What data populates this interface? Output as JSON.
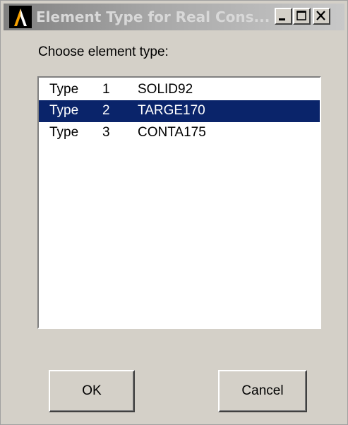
{
  "window": {
    "title": "Element Type for Real Cons...",
    "controls": {
      "minimize_icon": "minimize-icon",
      "maximize_icon": "maximize-icon",
      "close_icon": "close-icon"
    }
  },
  "prompt": "Choose element type:",
  "element_types": [
    {
      "label": "Type",
      "number": "1",
      "name": "SOLID92",
      "selected": false
    },
    {
      "label": "Type",
      "number": "2",
      "name": "TARGE170",
      "selected": true
    },
    {
      "label": "Type",
      "number": "3",
      "name": "CONTA175",
      "selected": false
    }
  ],
  "buttons": {
    "ok": "OK",
    "cancel": "Cancel"
  },
  "colors": {
    "selection": "#0a246a",
    "dialog_face": "#d4d0c8"
  }
}
